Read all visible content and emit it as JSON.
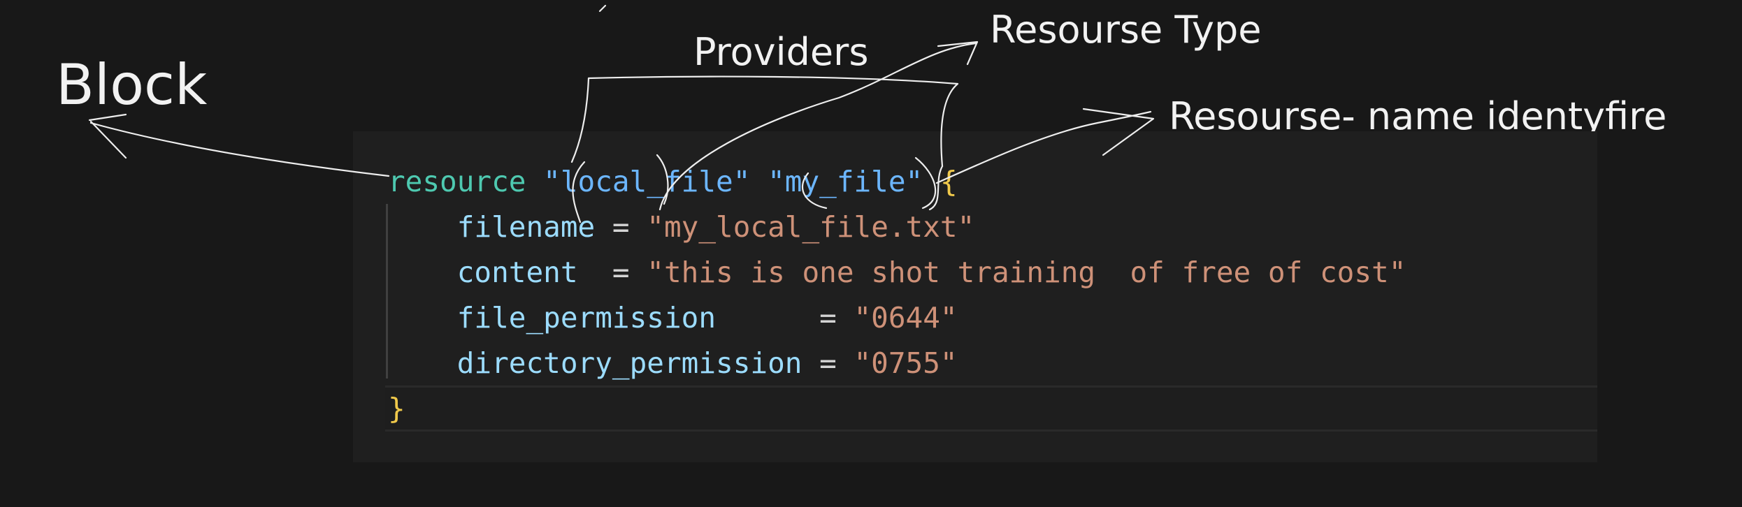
{
  "annotations": {
    "block": "Block",
    "providers": "Providers",
    "resource_type": "Resourse Type",
    "resource_name": "Resourse- name identyfire"
  },
  "code": {
    "keyword": "resource",
    "type": "\"local_file\"",
    "name": "\"my_file\"",
    "open_brace": "{",
    "attributes": [
      {
        "key": "filename",
        "op": " = ",
        "value": "\"my_local_file.txt\""
      },
      {
        "key": "content",
        "op": "  = ",
        "value": "\"this is one shot training  of free of cost\""
      },
      {
        "key": "file_permission",
        "op": "      = ",
        "value": "\"0644\""
      },
      {
        "key": "directory_permission",
        "op": " = ",
        "value": "\"0755\""
      }
    ],
    "close_brace": "}"
  },
  "colors": {
    "background": "#181818",
    "panel": "#1f1f1f",
    "keyword": "#4ec9b0",
    "string_type": "#6cb6ff",
    "brace": "#f0c94b",
    "attribute": "#9cdcfe",
    "value": "#ce9178",
    "annotation": "#f2f2f2"
  }
}
